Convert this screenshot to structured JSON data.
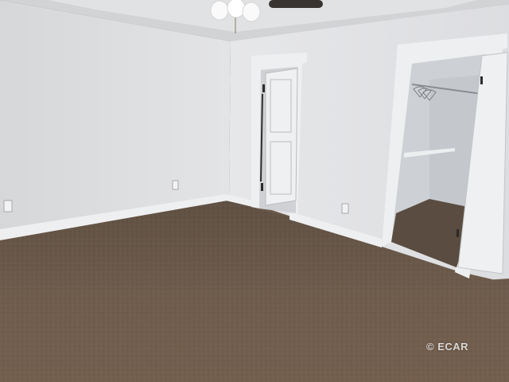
{
  "watermark": {
    "text": "© ECAR"
  },
  "colors": {
    "wall": "#dfe0e2",
    "wall_shadow": "#c9cacd",
    "ceiling": "#d3d4d6",
    "trim": "#eeeff0",
    "carpet": "#6b5a4b",
    "closet_dark": "#5a4c40"
  }
}
